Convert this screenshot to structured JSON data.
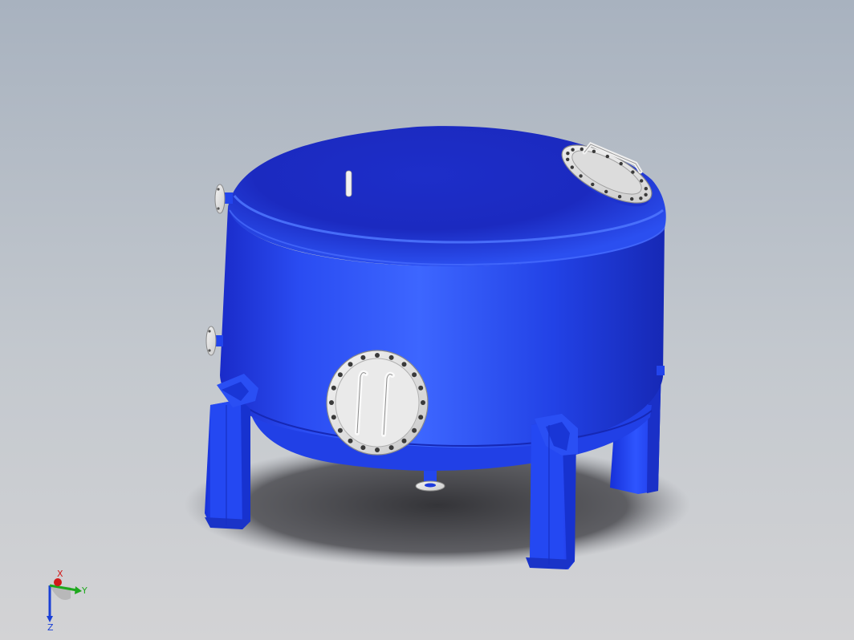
{
  "viewport": {
    "background_top": "#a8b2bf",
    "background_bottom": "#d3d3d5"
  },
  "model": {
    "body_color": "#1f36e0",
    "body_highlight": "#3d66ff",
    "flange_color": "#e6e6e6",
    "bolt_color": "#3a3a3a"
  },
  "triad": {
    "x_label": "X",
    "y_label": "Y",
    "z_label": "Z",
    "x_color": "#d11a1a",
    "y_color": "#1ea81e",
    "z_color": "#1a3fd6"
  }
}
